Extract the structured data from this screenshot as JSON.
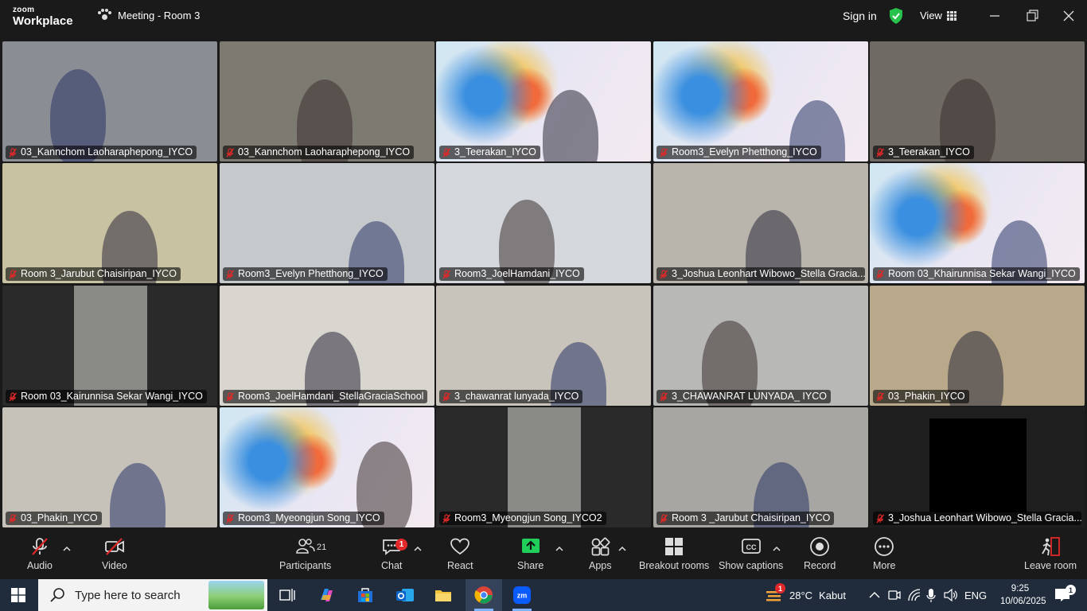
{
  "titlebar": {
    "logo_line1": "zoom",
    "logo_line2": "Workplace",
    "meeting_title": "Meeting - Room 3",
    "signin": "Sign in",
    "view": "View"
  },
  "tiles": [
    {
      "name": "03_Kannchom Laoharaphepong_IYCO",
      "bg": "#8a8e94",
      "muted": true
    },
    {
      "name": "03_Kannchom Laoharaphepong_IYCO",
      "bg": "#7d7a72",
      "muted": true
    },
    {
      "name": "3_Teerakan_IYCO",
      "bg": "virtual",
      "muted": true
    },
    {
      "name": "Room3_Evelyn Phetthong_IYCO",
      "bg": "virtual",
      "muted": true
    },
    {
      "name": "3_Teerakan_IYCO",
      "bg": "#6f6a64",
      "muted": true
    },
    {
      "name": "Room 3_Jarubut Chaisiripan_IYCO",
      "bg": "#c9c2a2",
      "muted": true
    },
    {
      "name": "Room3_Evelyn Phetthong_IYCO",
      "bg": "#c5c9cc",
      "muted": true
    },
    {
      "name": "Room3_JoelHamdani_IYCO",
      "bg": "#d4d8dc",
      "muted": true
    },
    {
      "name": "3_Joshua Leonhart Wibowo_Stella Gracia...",
      "bg": "#b9b5ad",
      "muted": true
    },
    {
      "name": "Room 03_Khairunnisa Sekar Wangi_IYCO",
      "bg": "virtual",
      "muted": true
    },
    {
      "name": "Room 03_Kairunnisa Sekar Wangi_IYCO",
      "bg": "#2a2a2a",
      "muted": true
    },
    {
      "name": "Room3_JoelHamdani_StellaGraciaSchool",
      "bg": "#d9d6d0",
      "muted": true
    },
    {
      "name": "3_chawanrat lunyada_IYCO",
      "bg": "#c8c4bb",
      "muted": true
    },
    {
      "name": "3_CHAWANRAT LUNYADA_ IYCO",
      "bg": "#b8b8b6",
      "muted": true
    },
    {
      "name": "03_Phakin_IYCO",
      "bg": "#b9a98a",
      "muted": true
    },
    {
      "name": "03_Phakin_IYCO",
      "bg": "#c6c2ba",
      "muted": true
    },
    {
      "name": "Room3_Myeongjun Song_IYCO",
      "bg": "virtual",
      "muted": true
    },
    {
      "name": "Room3_Myeongjun Song_IYCO2",
      "bg": "#2a2a2a",
      "muted": true
    },
    {
      "name": "Room 3 _Jarubut Chaisiripan_IYCO",
      "bg": "#a8a6a2",
      "muted": true
    },
    {
      "name": "3_Joshua Leonhart Wibowo_Stella Gracia...",
      "bg": "#1e1e1e",
      "muted": true,
      "active": true
    }
  ],
  "toolbar": {
    "audio": "Audio",
    "video": "Video",
    "participants": "Participants",
    "participants_count": "21",
    "chat": "Chat",
    "chat_badge": "1",
    "react": "React",
    "share": "Share",
    "apps": "Apps",
    "breakout": "Breakout rooms",
    "captions": "Show captions",
    "record": "Record",
    "more": "More",
    "leave": "Leave room"
  },
  "taskbar": {
    "search_placeholder": "Type here to search",
    "weather_temp": "28°C",
    "weather_desc": "Kabut",
    "weather_badge": "1",
    "lang": "ENG",
    "time": "9:25",
    "date": "10/06/2025",
    "notif_count": "1"
  },
  "colors": {
    "accent_green": "#36d46b",
    "mute_red": "#e02828",
    "share_green": "#1fcf5a",
    "leave_red": "#e02828"
  }
}
